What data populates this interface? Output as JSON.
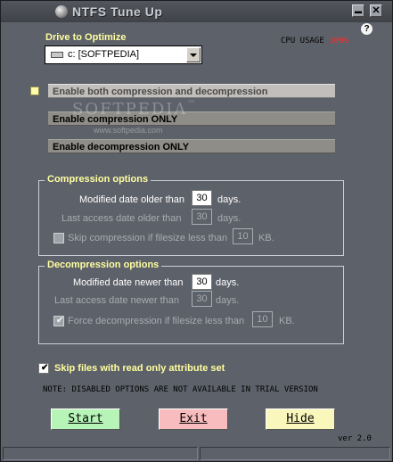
{
  "window": {
    "title": "NTFS Tune Up",
    "minimize_glyph": "▬",
    "close_glyph": "✕",
    "help_glyph": "?"
  },
  "drive": {
    "label": "Drive to Optimize",
    "selected": "c: [SOFTPEDIA]"
  },
  "cpu": {
    "label": "CPU USAGE",
    "value": "100%"
  },
  "modes": {
    "both": "Enable both compression and decompression",
    "compress_only": "Enable compression ONLY",
    "decompress_only": "Enable decompression ONLY"
  },
  "watermark": {
    "brand": "SOFTPEDIA",
    "trademark": "™",
    "url": "www.softpedia.com"
  },
  "compression": {
    "title": "Compression options",
    "modified_label": "Modified date older than",
    "modified_value": "30",
    "modified_unit": "days.",
    "access_label": "Last access date older than",
    "access_value": "30",
    "access_unit": "days.",
    "skip_label": "Skip compression if filesize less than",
    "skip_value": "10",
    "skip_unit": "KB."
  },
  "decompression": {
    "title": "Decompression options",
    "modified_label": "Modified date newer than",
    "modified_value": "30",
    "modified_unit": "days.",
    "access_label": "Last access date newer than",
    "access_value": "30",
    "access_unit": "days.",
    "force_label": "Force decompression if filesize less than",
    "force_value": "10",
    "force_unit": "KB."
  },
  "skip_readonly": {
    "label": "Skip files with read only attribute set",
    "checked": true
  },
  "note": "NOTE: DISABLED OPTIONS ARE NOT AVAILABLE IN TRIAL VERSION",
  "buttons": {
    "start": "Start",
    "exit": "Exit",
    "hide": "Hide"
  },
  "version": "ver 2.0",
  "colors": {
    "background": "#5d6169",
    "accent_text": "#fffea0",
    "cpu_value": "#ff2b2b",
    "start_button": "#b6f4b8",
    "exit_button": "#f8bcbe",
    "hide_button": "#f9f7bb"
  }
}
